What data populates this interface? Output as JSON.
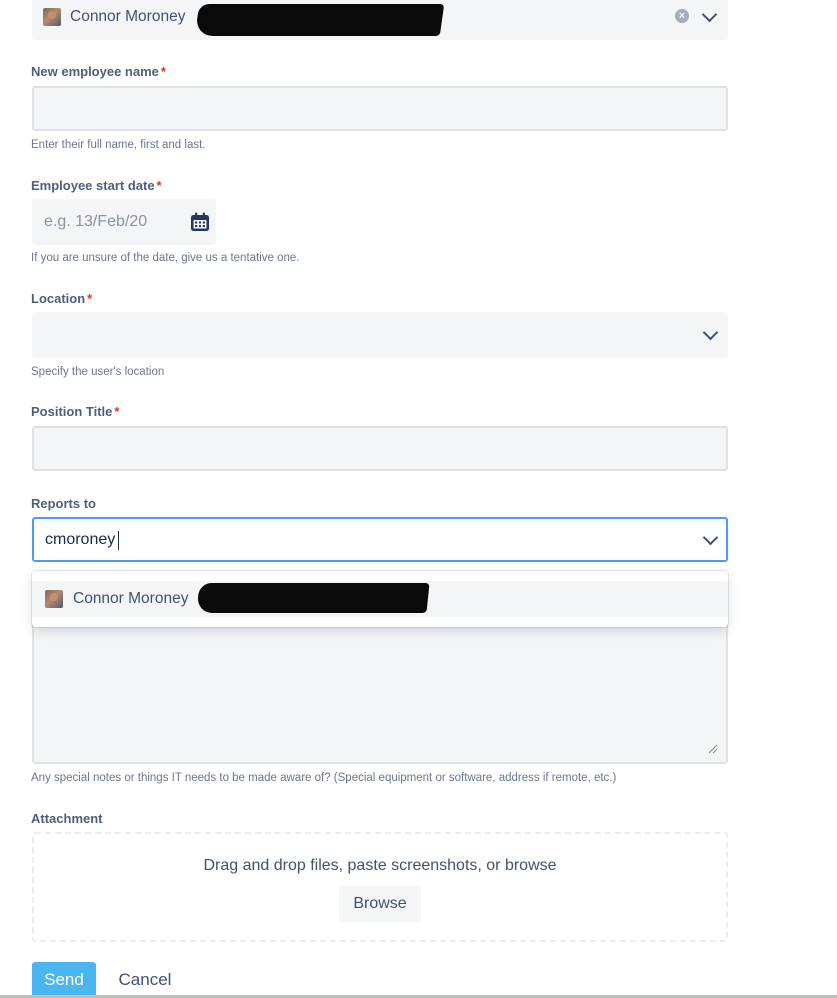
{
  "top_select": {
    "selected": "Connor Moroney"
  },
  "new_employee": {
    "label": "New employee name",
    "help": "Enter their full name, first and last.",
    "value": ""
  },
  "start_date": {
    "label": "Employee start date",
    "placeholder": "e.g. 13/Feb/20",
    "help": "If you are unsure of the date, give us a tentative one."
  },
  "location": {
    "label": "Location",
    "help": "Specify the user's location",
    "value": ""
  },
  "position_title": {
    "label": "Position Title",
    "value": ""
  },
  "reports_to": {
    "label": "Reports to",
    "value": "cmoroney",
    "option": "Connor Moroney"
  },
  "notes": {
    "help": "Any special notes or things IT needs to be made aware of? (Special equipment or software, address if remote, etc.)"
  },
  "attachment": {
    "label": "Attachment",
    "drop_text": "Drag and drop files, paste screenshots, or browse",
    "browse_label": "Browse"
  },
  "actions": {
    "send_label": "Send",
    "cancel_label": "Cancel"
  },
  "required_marker": "*",
  "colors": {
    "accent": "#4c9aff",
    "send": "#4bb5f0",
    "required": "#de350b"
  }
}
